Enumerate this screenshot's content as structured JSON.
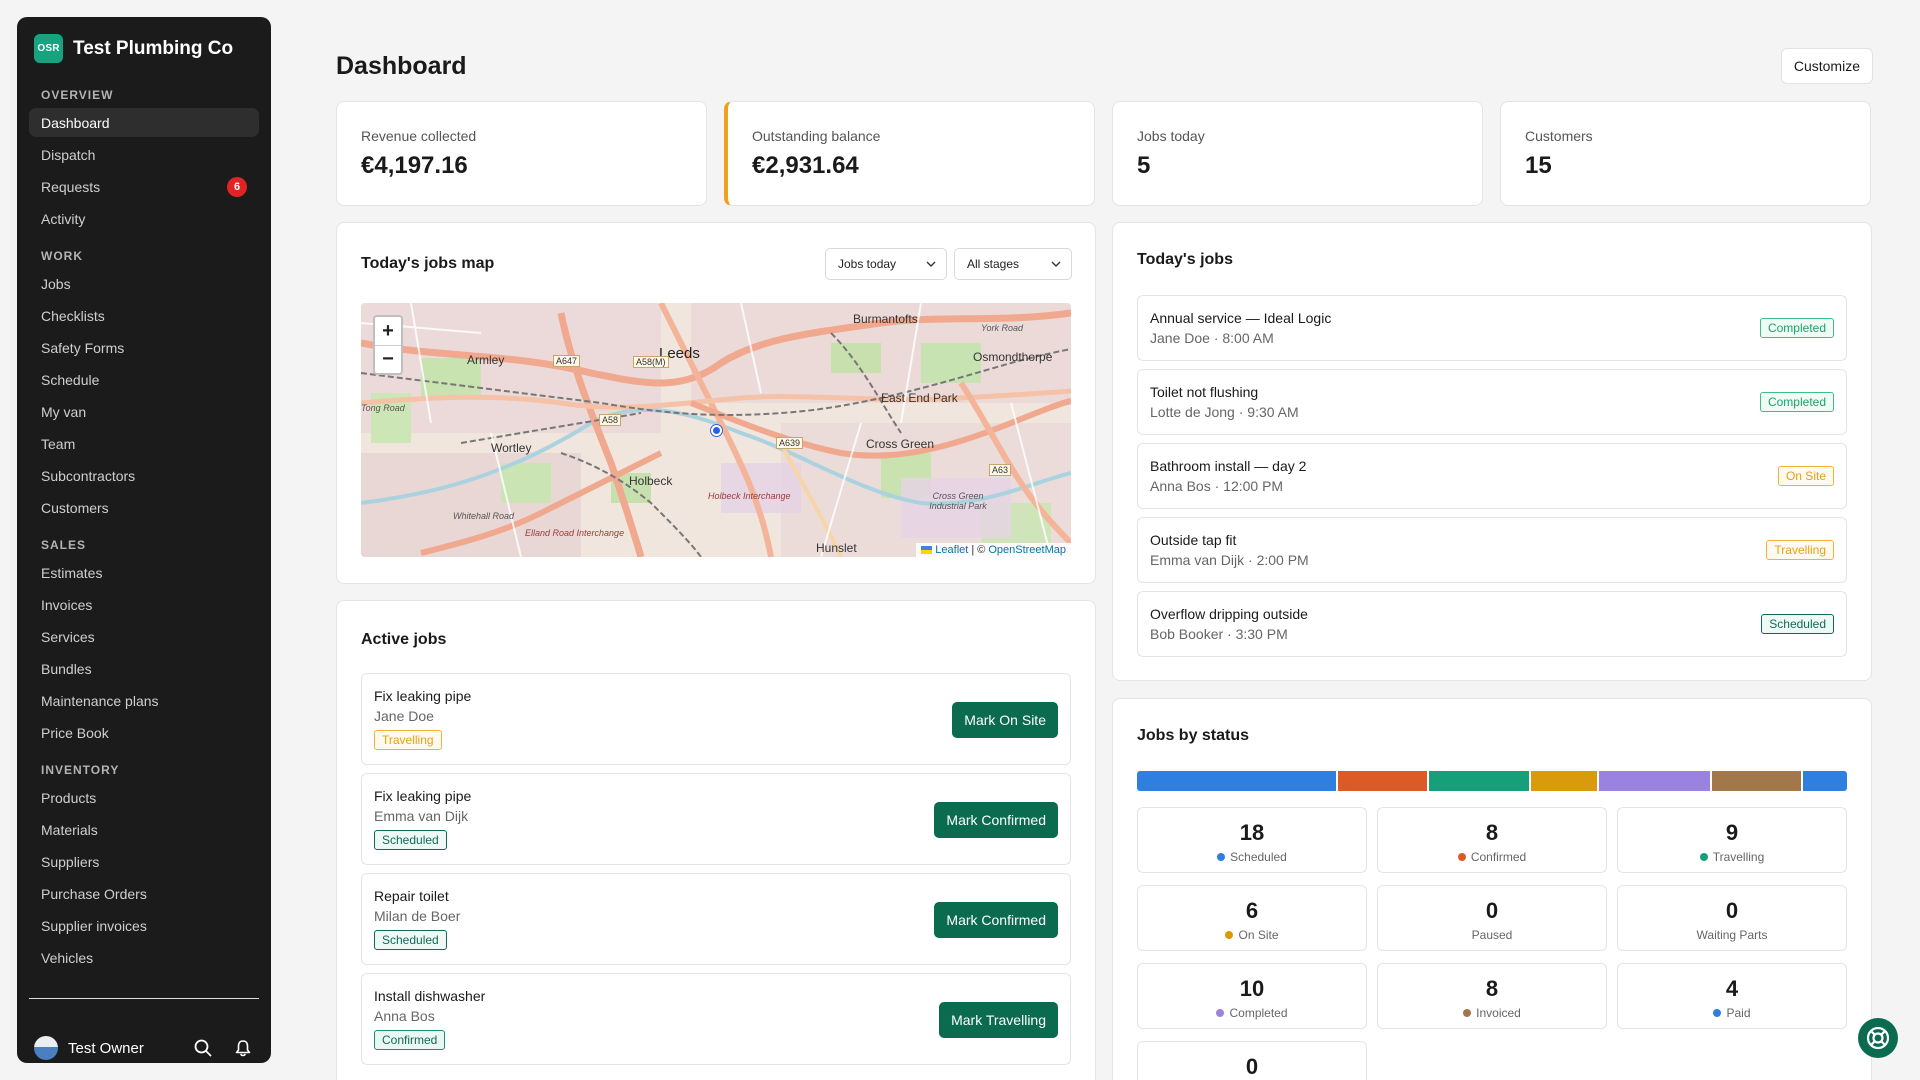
{
  "brand": {
    "logo": "OSR",
    "name": "Test Plumbing Co"
  },
  "nav": {
    "overview_label": "OVERVIEW",
    "overview": [
      {
        "label": "Dashboard",
        "active": true
      },
      {
        "label": "Dispatch"
      },
      {
        "label": "Requests",
        "badge": "6"
      },
      {
        "label": "Activity"
      }
    ],
    "work_label": "WORK",
    "work": [
      {
        "label": "Jobs"
      },
      {
        "label": "Checklists"
      },
      {
        "label": "Safety Forms"
      },
      {
        "label": "Schedule"
      },
      {
        "label": "My van"
      },
      {
        "label": "Team"
      },
      {
        "label": "Subcontractors"
      },
      {
        "label": "Customers"
      }
    ],
    "sales_label": "SALES",
    "sales": [
      {
        "label": "Estimates"
      },
      {
        "label": "Invoices"
      },
      {
        "label": "Services"
      },
      {
        "label": "Bundles"
      },
      {
        "label": "Maintenance plans"
      },
      {
        "label": "Price Book"
      }
    ],
    "inventory_label": "INVENTORY",
    "inventory": [
      {
        "label": "Products"
      },
      {
        "label": "Materials"
      },
      {
        "label": "Suppliers"
      },
      {
        "label": "Purchase Orders"
      },
      {
        "label": "Supplier invoices"
      },
      {
        "label": "Vehicles"
      }
    ]
  },
  "footer": {
    "owner": "Test Owner",
    "icons": [
      "search-icon",
      "bell-icon"
    ]
  },
  "header": {
    "title": "Dashboard",
    "customize": "Customize"
  },
  "stats": [
    {
      "label": "Revenue collected",
      "value": "€4,197.16"
    },
    {
      "label": "Outstanding balance",
      "value": "€2,931.64",
      "accent": "#f0a01e"
    },
    {
      "label": "Jobs today",
      "value": "5"
    },
    {
      "label": "Customers",
      "value": "15"
    }
  ],
  "map_panel": {
    "title": "Today's jobs map",
    "filter_date": "Jobs today",
    "filter_stage": "All stages",
    "zoom_in": "+",
    "zoom_out": "−",
    "attribution": {
      "leaflet": "Leaflet",
      "sep": "| ©",
      "osm": "OpenStreetMap"
    },
    "places": {
      "leeds": "Leeds",
      "armley": "Armley",
      "burmantofts": "Burmantofts",
      "osmondthorpe": "Osmondthorpe",
      "east_end_park": "East End Park",
      "wortley": "Wortley",
      "holbeck": "Holbeck",
      "cross_green": "Cross Green",
      "hunslet": "Hunslet",
      "cross_green_ind": "Cross Green Industrial Park",
      "holbeck_interchange": "Holbeck Interchange",
      "elland_interchange": "Elland Road Interchange",
      "tong_road": "Tong Road",
      "whitehall_road": "Whitehall Road",
      "york_road": "York Road",
      "a647": "A647",
      "a58m": "A58(M)",
      "a58": "A58",
      "a639": "A639",
      "a63": "A63"
    }
  },
  "active_jobs": {
    "title": "Active jobs",
    "items": [
      {
        "title": "Fix leaking pipe",
        "customer": "Jane Doe",
        "status": "Travelling",
        "status_key": "travelling",
        "action": "Mark On Site"
      },
      {
        "title": "Fix leaking pipe",
        "customer": "Emma van Dijk",
        "status": "Scheduled",
        "status_key": "scheduled",
        "action": "Mark Confirmed"
      },
      {
        "title": "Repair toilet",
        "customer": "Milan de Boer",
        "status": "Scheduled",
        "status_key": "scheduled",
        "action": "Mark Confirmed"
      },
      {
        "title": "Install dishwasher",
        "customer": "Anna Bos",
        "status": "Confirmed",
        "status_key": "confirmed",
        "action": "Mark Travelling"
      }
    ]
  },
  "todays_jobs": {
    "title": "Today's jobs",
    "items": [
      {
        "title": "Annual service — Ideal Logic",
        "sub": "Jane Doe · 8:00 AM",
        "status": "Completed",
        "status_key": "completed"
      },
      {
        "title": "Toilet not flushing",
        "sub": "Lotte de Jong · 9:30 AM",
        "status": "Completed",
        "status_key": "completed"
      },
      {
        "title": "Bathroom install — day 2",
        "sub": "Anna Bos · 12:00 PM",
        "status": "On Site",
        "status_key": "onsite"
      },
      {
        "title": "Outside tap fit",
        "sub": "Emma van Dijk · 2:00 PM",
        "status": "Travelling",
        "status_key": "travelling"
      },
      {
        "title": "Overflow dripping outside",
        "sub": "Bob Booker · 3:30 PM",
        "status": "Scheduled",
        "status_key": "scheduled"
      }
    ]
  },
  "jobs_by_status": {
    "title": "Jobs by status",
    "tiles": [
      {
        "count": "18",
        "label": "Scheduled",
        "color": "#2f7fe0"
      },
      {
        "count": "8",
        "label": "Confirmed",
        "color": "#dc5a26"
      },
      {
        "count": "9",
        "label": "Travelling",
        "color": "#16a07a"
      },
      {
        "count": "6",
        "label": "On Site",
        "color": "#d99a0b"
      },
      {
        "count": "0",
        "label": "Paused",
        "color": ""
      },
      {
        "count": "0",
        "label": "Waiting Parts",
        "color": ""
      },
      {
        "count": "10",
        "label": "Completed",
        "color": "#9a82e0"
      },
      {
        "count": "8",
        "label": "Invoiced",
        "color": "#a2784a"
      },
      {
        "count": "4",
        "label": "Paid",
        "color": "#2f7fe0"
      },
      {
        "count": "0",
        "label": "",
        "color": ""
      }
    ]
  },
  "help": {
    "icon": "lifebuoy-icon"
  }
}
